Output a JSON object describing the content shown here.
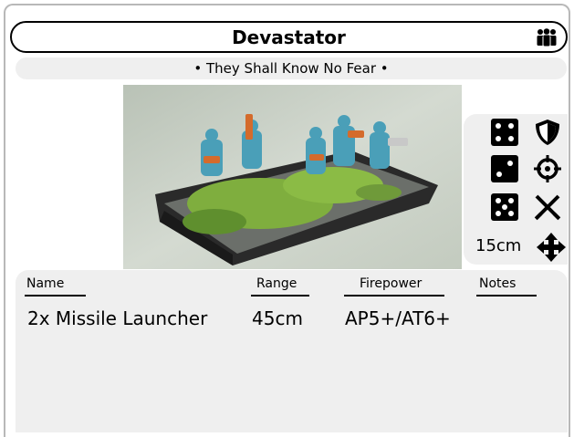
{
  "unit": {
    "name": "Devastator",
    "special_rule": "• They Shall Know No Fear •",
    "unit_type_icon": "infantry-group-icon",
    "photo_description_icon": "miniatures-photo"
  },
  "stats": {
    "armour_icon": "dice-four-icon",
    "armour_type_icon": "shield-icon",
    "close_combat_icon": "dice-two-icon",
    "firefight_icon": "crosshair-icon",
    "assault_icon": "dice-five-icon",
    "melee_icon": "crossed-swords-icon",
    "move_value": "15cm",
    "move_icon": "move-arrows-icon"
  },
  "weapons": {
    "headers": [
      "Name",
      "Range",
      "Firepower",
      "Notes"
    ],
    "rows": [
      {
        "name": "2x Missile Launcher",
        "range": "45cm",
        "firepower": "AP5+/AT6+",
        "notes": ""
      }
    ]
  }
}
